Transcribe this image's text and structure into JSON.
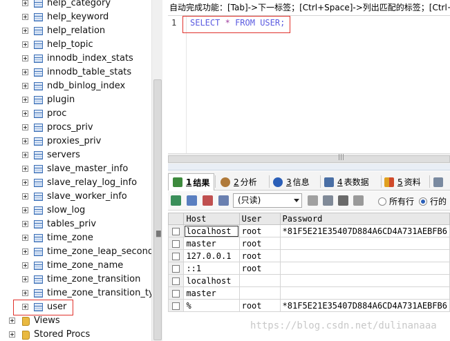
{
  "tree": {
    "items": [
      {
        "label": "help_category",
        "kind": "table"
      },
      {
        "label": "help_keyword",
        "kind": "table"
      },
      {
        "label": "help_relation",
        "kind": "table"
      },
      {
        "label": "help_topic",
        "kind": "table"
      },
      {
        "label": "innodb_index_stats",
        "kind": "table"
      },
      {
        "label": "innodb_table_stats",
        "kind": "table"
      },
      {
        "label": "ndb_binlog_index",
        "kind": "table"
      },
      {
        "label": "plugin",
        "kind": "table"
      },
      {
        "label": "proc",
        "kind": "table"
      },
      {
        "label": "procs_priv",
        "kind": "table"
      },
      {
        "label": "proxies_priv",
        "kind": "table"
      },
      {
        "label": "servers",
        "kind": "table"
      },
      {
        "label": "slave_master_info",
        "kind": "table"
      },
      {
        "label": "slave_relay_log_info",
        "kind": "table"
      },
      {
        "label": "slave_worker_info",
        "kind": "table"
      },
      {
        "label": "slow_log",
        "kind": "table"
      },
      {
        "label": "tables_priv",
        "kind": "table"
      },
      {
        "label": "time_zone",
        "kind": "table"
      },
      {
        "label": "time_zone_leap_second",
        "kind": "table"
      },
      {
        "label": "time_zone_name",
        "kind": "table"
      },
      {
        "label": "time_zone_transition",
        "kind": "table"
      },
      {
        "label": "time_zone_transition_type",
        "kind": "table"
      },
      {
        "label": "user",
        "kind": "table"
      },
      {
        "label": "Views",
        "kind": "folder"
      },
      {
        "label": "Stored Procs",
        "kind": "folder"
      }
    ]
  },
  "editor": {
    "hint": "自动完成功能：[Tab]->下一标签；[Ctrl+Space]->列出匹配的标签；[Ctrl+",
    "line_number": "1",
    "sql_kw1": "SELECT",
    "sql_star": "*",
    "sql_kw2": "FROM",
    "sql_rest": "USER;"
  },
  "tabs": [
    {
      "num": "1",
      "label": "结果",
      "icon": "result-icon",
      "color": "#3d8a3d"
    },
    {
      "num": "2",
      "label": "分析",
      "icon": "profile-icon",
      "color": "#b07a3a"
    },
    {
      "num": "3",
      "label": "信息",
      "icon": "info-icon",
      "color": "#2b5fb8"
    },
    {
      "num": "4",
      "label": "表数据",
      "icon": "table-data-icon",
      "color": "#4a6fa5"
    },
    {
      "num": "5",
      "label": "资料",
      "icon": "info-shapes-icon",
      "color": "#d04a2a"
    }
  ],
  "toolbar": {
    "mode": "(只读)",
    "radio_all": "所有行",
    "radio_page": "行的"
  },
  "grid": {
    "columns": [
      "Host",
      "User",
      "Password"
    ],
    "rows": [
      [
        "localhost",
        "root",
        "*81F5E21E35407D884A6CD4A731AEBFB6"
      ],
      [
        "master",
        "root",
        ""
      ],
      [
        "127.0.0.1",
        "root",
        ""
      ],
      [
        "::1",
        "root",
        ""
      ],
      [
        "localhost",
        "",
        ""
      ],
      [
        "master",
        "",
        ""
      ],
      [
        "%",
        "root",
        "*81F5E21E35407D884A6CD4A731AEBFB6"
      ]
    ]
  },
  "watermark": "https://blog.csdn.net/dulinanaaa",
  "colors": {
    "accent_red": "#e0302a",
    "sql_keyword": "#5a5ae0"
  }
}
